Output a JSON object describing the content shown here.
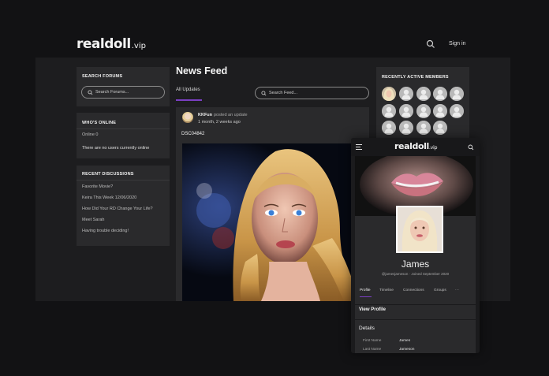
{
  "header": {
    "logo_main": "realdoll",
    "logo_suffix": ".vip",
    "search_icon": "search-icon",
    "signin_label": "Sign in"
  },
  "sidebar": {
    "search_title": "SEARCH FORUMS",
    "search_placeholder": "Search Forums...",
    "online_title": "WHO'S ONLINE",
    "online_count": "Online 0",
    "online_empty": "There are no users currently online",
    "recent_title": "RECENT DISCUSSIONS",
    "discussions": [
      "Favorite Movie?",
      "Keira This Week 12/06/2020",
      "How Did Your RD Change Your Life?",
      "Meet Sarah",
      "Having trouble deciding!"
    ]
  },
  "feed": {
    "title": "News Feed",
    "tab_all": "All Updates",
    "search_placeholder": "Search Feed...",
    "post": {
      "author": "KKFun",
      "action": "posted an update",
      "time": "1 month, 2 weeks ago",
      "caption": "DSC04842"
    }
  },
  "members": {
    "title": "RECENTLY ACTIVE MEMBERS",
    "icon": "user-silhouette-icon"
  },
  "mobile": {
    "logo_main": "realdoll",
    "logo_suffix": ".vip",
    "menu_icon": "hamburger-icon",
    "search_icon": "search-icon",
    "profile_name": "James",
    "profile_handle": "@jamesjameson · Joined September 2020",
    "tabs": [
      "Profile",
      "Timeline",
      "Connections",
      "Groups",
      "···"
    ],
    "view_profile": "View Profile",
    "details_title": "Details",
    "fields": [
      {
        "label": "First Name",
        "value": "James"
      },
      {
        "label": "Last Name",
        "value": "Jameson"
      }
    ]
  },
  "colors": {
    "background": "#121214",
    "panel": "#1d1d1f",
    "card": "#2a2a2c",
    "accent": "#7a3fc2"
  }
}
